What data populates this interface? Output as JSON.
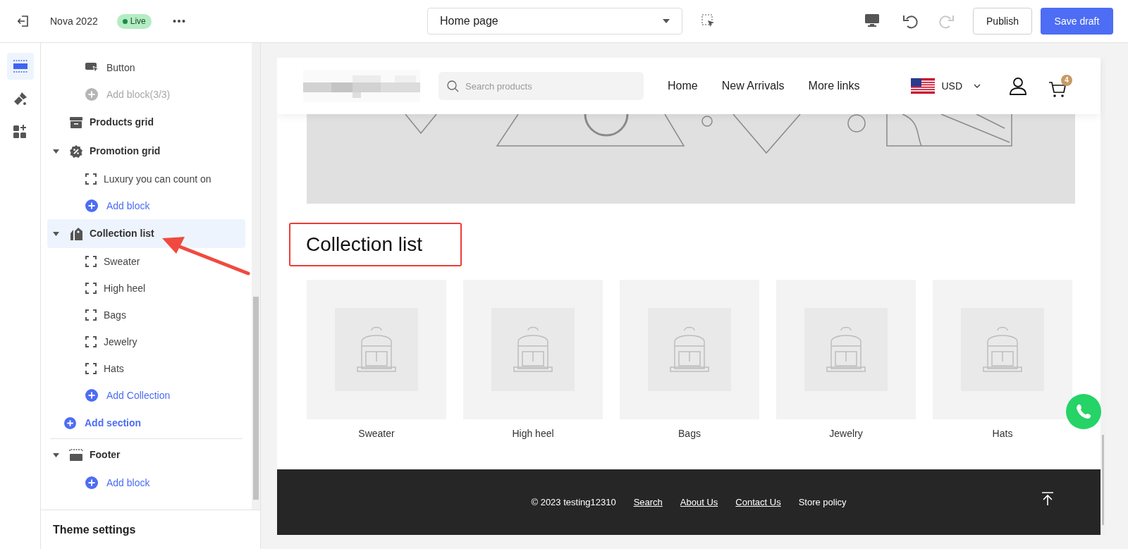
{
  "topbar": {
    "theme_name": "Nova 2022",
    "status": "Live",
    "page_select": "Home page",
    "history": [
      {
        "kind": "undo",
        "disabled": false
      },
      {
        "kind": "redo",
        "disabled": true
      }
    ],
    "publish": "Publish",
    "save": "Save draft"
  },
  "rail": [
    {
      "kind": "sections",
      "selected": true
    },
    {
      "kind": "theme",
      "selected": false
    },
    {
      "kind": "apps",
      "selected": false
    }
  ],
  "tree": {
    "scrolled_blocks": [
      {
        "kind": "button",
        "label": "Button",
        "disabled": false
      },
      {
        "kind": "add",
        "label": "Add block(3/3)",
        "disabled": true
      }
    ],
    "sections": [
      {
        "kind": "archive",
        "label": "Products grid",
        "selected": false
      },
      {
        "kind": "percent",
        "label": "Promotion grid",
        "selected": false,
        "expanded": true,
        "children": [
          {
            "kind": "block",
            "label": "Luxury you can count on",
            "disabled": false
          },
          {
            "kind": "add",
            "label": "Add block",
            "disabled": false
          }
        ]
      },
      {
        "kind": "tag",
        "label": "Collection list",
        "selected": true,
        "expanded": true,
        "children": [
          {
            "kind": "block",
            "label": "Sweater",
            "disabled": false
          },
          {
            "kind": "block",
            "label": "High heel",
            "disabled": false
          },
          {
            "kind": "block",
            "label": "Bags",
            "disabled": false
          },
          {
            "kind": "block",
            "label": "Jewelry",
            "disabled": false
          },
          {
            "kind": "block",
            "label": "Hats",
            "disabled": false
          },
          {
            "kind": "add",
            "label": "Add Collection",
            "disabled": false
          }
        ]
      }
    ],
    "add_section": "Add section",
    "footer_section": {
      "kind": "footer",
      "label": "Footer",
      "selected": false,
      "expanded": true,
      "children": [
        {
          "kind": "add",
          "label": "Add block",
          "disabled": false
        }
      ]
    },
    "theme_settings": "Theme settings"
  },
  "preview": {
    "search_placeholder": "Search products",
    "nav": [
      "Home",
      "New Arrivals",
      "More links"
    ],
    "currency": "USD",
    "cart_count": "4",
    "collection_title": "Collection list",
    "collections": [
      "Sweater",
      "High heel",
      "Bags",
      "Jewelry",
      "Hats"
    ],
    "footer": {
      "copyright": "© 2023 testing12310",
      "links": [
        {
          "label": "Search",
          "underlined": true
        },
        {
          "label": "About Us",
          "underlined": true
        },
        {
          "label": "Contact Us",
          "underlined": true
        },
        {
          "label": "Store policy",
          "underlined": false
        }
      ]
    }
  }
}
